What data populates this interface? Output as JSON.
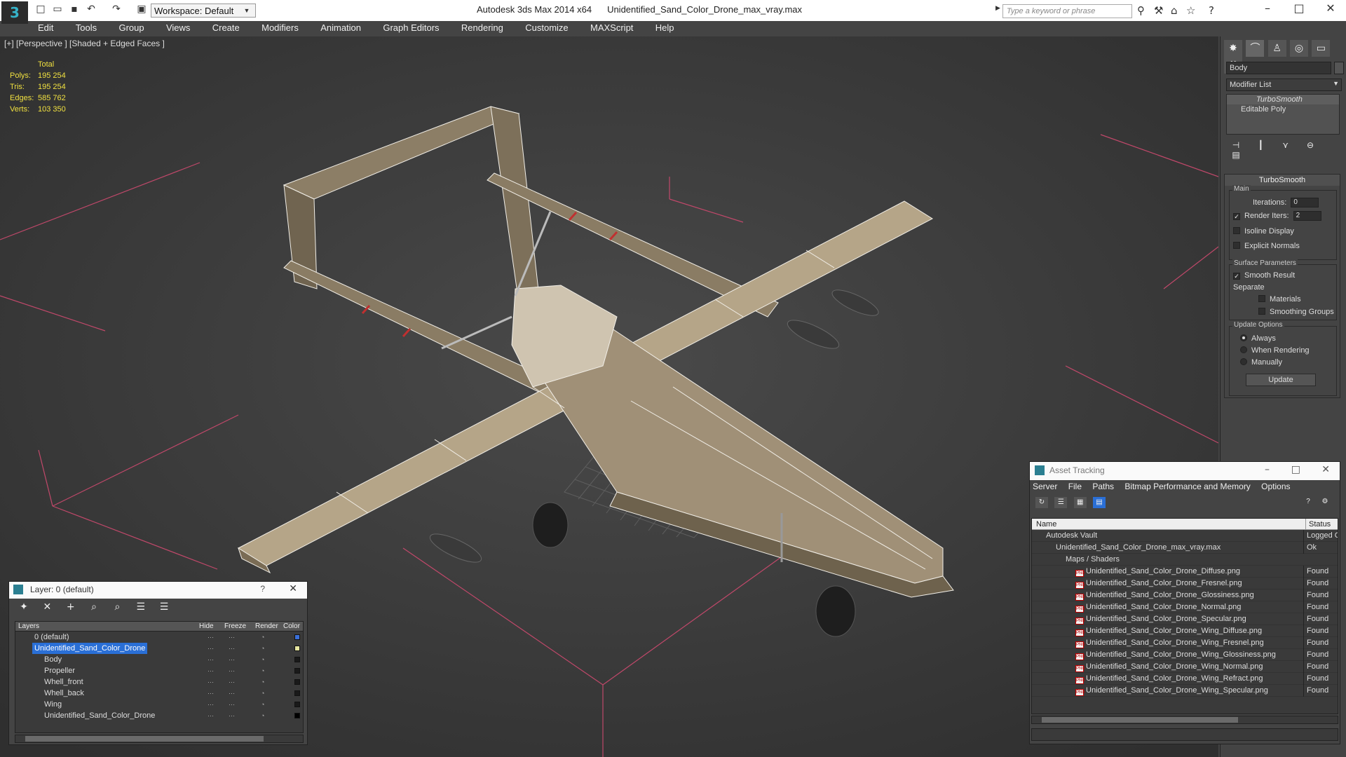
{
  "titlebar": {
    "workspace": "Workspace: Default",
    "app": "Autodesk 3ds Max  2014 x64",
    "file": "Unidentified_Sand_Color_Drone_max_vray.max",
    "search_placeholder": "Type a keyword or phrase"
  },
  "menu": [
    "Edit",
    "Tools",
    "Group",
    "Views",
    "Create",
    "Modifiers",
    "Animation",
    "Graph Editors",
    "Rendering",
    "Customize",
    "MAXScript",
    "Help"
  ],
  "viewport": {
    "label": "[+] [Perspective ] [Shaded + Edged Faces ]",
    "stats": {
      "header": "Total",
      "rows": [
        {
          "k": "Polys:",
          "v": "195 254"
        },
        {
          "k": "Tris:",
          "v": "195 254"
        },
        {
          "k": "Edges:",
          "v": "585 762"
        },
        {
          "k": "Verts:",
          "v": "103 350"
        }
      ]
    }
  },
  "command_panel": {
    "object_name": "Body",
    "modifier_list": "Modifier List",
    "stack": [
      "TurboSmooth",
      "Editable Poly"
    ],
    "rollout_title": "TurboSmooth",
    "main_label": "Main",
    "iterations_label": "Iterations:",
    "iterations_value": "0",
    "render_iters_label": "Render Iters:",
    "render_iters_value": "2",
    "isoline": "Isoline Display",
    "explicit_normals": "Explicit Normals",
    "surface_params": "Surface Parameters",
    "smooth_result": "Smooth Result",
    "separate": "Separate",
    "materials": "Materials",
    "smoothing_groups": "Smoothing Groups",
    "update_options": "Update Options",
    "always": "Always",
    "when_rendering": "When Rendering",
    "manually": "Manually",
    "update_button": "Update"
  },
  "layer_window": {
    "title": "Layer: 0 (default)",
    "help": "?",
    "columns": {
      "layers": "Layers",
      "hide": "Hide",
      "freeze": "Freeze",
      "render": "Render",
      "color": "Color"
    },
    "rows": [
      {
        "name": "0 (default)",
        "indent": 0,
        "color": "#3a6fd8"
      },
      {
        "name": "Unidentified_Sand_Color_Drone",
        "indent": 0,
        "color": "#e6e6a0",
        "selected": true
      },
      {
        "name": "Body",
        "indent": 1,
        "color": "#1a1a1a"
      },
      {
        "name": "Propeller",
        "indent": 1,
        "color": "#1a1a1a"
      },
      {
        "name": "Whell_front",
        "indent": 1,
        "color": "#1a1a1a"
      },
      {
        "name": "Whell_back",
        "indent": 1,
        "color": "#1a1a1a"
      },
      {
        "name": "Wing",
        "indent": 1,
        "color": "#1a1a1a"
      },
      {
        "name": "Unidentified_Sand_Color_Drone",
        "indent": 1,
        "color": "#000000"
      }
    ]
  },
  "asset_window": {
    "title": "Asset Tracking",
    "menu": [
      "Server",
      "File",
      "Paths",
      "Bitmap Performance and Memory",
      "Options"
    ],
    "columns": {
      "name": "Name",
      "status": "Status"
    },
    "rows": [
      {
        "name": "Autodesk Vault",
        "indent": 0,
        "status": "Logged Out"
      },
      {
        "name": "Unidentified_Sand_Color_Drone_max_vray.max",
        "indent": 1,
        "status": "Ok"
      },
      {
        "name": "Maps / Shaders",
        "indent": 2,
        "status": ""
      },
      {
        "name": "Unidentified_Sand_Color_Drone_Diffuse.png",
        "indent": 3,
        "status": "Found"
      },
      {
        "name": "Unidentified_Sand_Color_Drone_Fresnel.png",
        "indent": 3,
        "status": "Found"
      },
      {
        "name": "Unidentified_Sand_Color_Drone_Glossiness.png",
        "indent": 3,
        "status": "Found"
      },
      {
        "name": "Unidentified_Sand_Color_Drone_Normal.png",
        "indent": 3,
        "status": "Found"
      },
      {
        "name": "Unidentified_Sand_Color_Drone_Specular.png",
        "indent": 3,
        "status": "Found"
      },
      {
        "name": "Unidentified_Sand_Color_Drone_Wing_Diffuse.png",
        "indent": 3,
        "status": "Found"
      },
      {
        "name": "Unidentified_Sand_Color_Drone_Wing_Fresnel.png",
        "indent": 3,
        "status": "Found"
      },
      {
        "name": "Unidentified_Sand_Color_Drone_Wing_Glossiness.png",
        "indent": 3,
        "status": "Found"
      },
      {
        "name": "Unidentified_Sand_Color_Drone_Wing_Normal.png",
        "indent": 3,
        "status": "Found"
      },
      {
        "name": "Unidentified_Sand_Color_Drone_Wing_Refract.png",
        "indent": 3,
        "status": "Found"
      },
      {
        "name": "Unidentified_Sand_Color_Drone_Wing_Specular.png",
        "indent": 3,
        "status": "Found"
      }
    ]
  }
}
